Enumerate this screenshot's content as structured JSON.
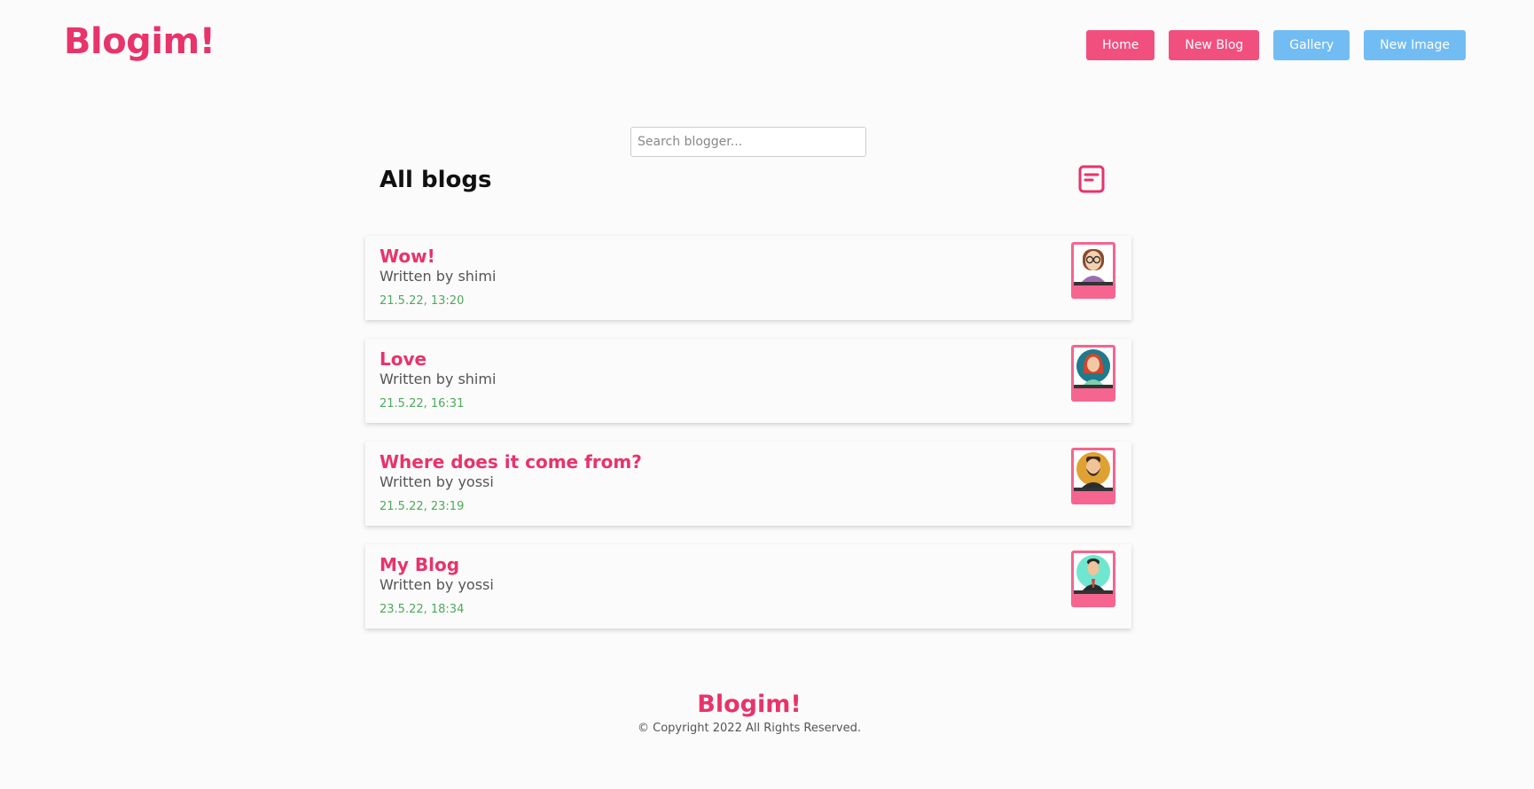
{
  "header": {
    "logo": "Blogim!",
    "nav": [
      {
        "label": "Home"
      },
      {
        "label": "New Blog"
      },
      {
        "label": "Gallery"
      },
      {
        "label": "New Image"
      }
    ]
  },
  "search": {
    "placeholder": "Search blogger..."
  },
  "main": {
    "title": "All blogs",
    "icon": "blog-list-icon",
    "blogs": [
      {
        "title": "Wow!",
        "author": "Written by shimi",
        "date": "21.5.22, 13:20",
        "avatar": "woman-glasses-avatar"
      },
      {
        "title": "Love",
        "author": "Written by shimi",
        "date": "21.5.22, 16:31",
        "avatar": "woman-redhair-avatar"
      },
      {
        "title": "Where does it come from?",
        "author": "Written by yossi",
        "date": "21.5.22, 23:19",
        "avatar": "man-beard-avatar"
      },
      {
        "title": "My Blog",
        "author": "Written by yossi",
        "date": "23.5.22, 18:34",
        "avatar": "man-suit-avatar"
      }
    ]
  },
  "footer": {
    "logo": "Blogim!",
    "copyright": "© Copyright 2022 All Rights Reserved."
  },
  "colors": {
    "brand": "#e8336b",
    "nav_pink": "#f1507f",
    "nav_blue": "#72bcf4",
    "date": "#4caa5a"
  }
}
